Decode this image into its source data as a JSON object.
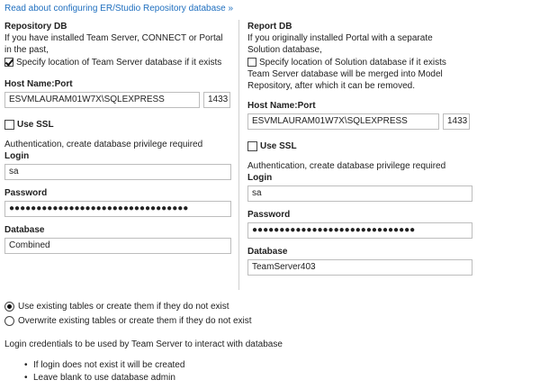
{
  "top_link": "Read about configuring ER/Studio Repository database »",
  "repository": {
    "heading": "Repository DB",
    "description": "If you have installed Team Server, CONNECT or Portal in the past,",
    "checkbox_label": "Specify location of Team Server database if it exists",
    "checkbox_checked": true,
    "host_label": "Host Name:Port",
    "host_value": "ESVMLAURAM01W7X\\SQLEXPRESS",
    "port_value": "1433",
    "ssl_label": "Use SSL",
    "ssl_checked": false,
    "auth_note": "Authentication, create database privilege required",
    "login_label": "Login",
    "login_value": "sa",
    "password_label": "Password",
    "password_value": "●●●●●●●●●●●●●●●●●●●●●●●●●●●●●●●●●",
    "database_label": "Database",
    "database_value": "Combined"
  },
  "report": {
    "heading": "Report DB",
    "description": "If you originally installed Portal with a separate Solution database,",
    "checkbox_label": "Specify location of Solution database if it exists",
    "checkbox_checked": false,
    "merge_note": "Team Server database will be merged into Model Repository, after which it can be removed.",
    "host_label": "Host Name:Port",
    "host_value": "ESVMLAURAM01W7X\\SQLEXPRESS",
    "port_value": "1433",
    "ssl_label": "Use SSL",
    "ssl_checked": false,
    "auth_note": "Authentication, create database privilege required",
    "login_label": "Login",
    "login_value": "sa",
    "password_label": "Password",
    "password_value": "●●●●●●●●●●●●●●●●●●●●●●●●●●●●●●",
    "database_label": "Database",
    "database_value": "TeamServer403"
  },
  "options": {
    "use_existing": "Use existing tables or create them if they do not exist",
    "overwrite": "Overwrite existing tables or create them if they do not exist",
    "selected": "use_existing"
  },
  "credentials_note": "Login credentials to be used by Team Server to interact with database",
  "bullets": [
    "If login does not exist it will be created",
    "Leave blank to use database admin"
  ]
}
